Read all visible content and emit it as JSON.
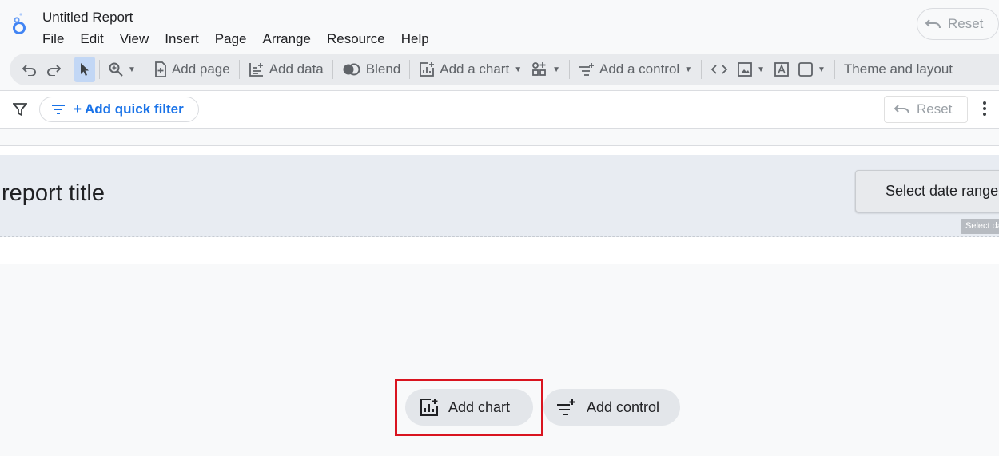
{
  "app": {
    "title": "Untitled Report",
    "reset_label": "Reset"
  },
  "menu": [
    "File",
    "Edit",
    "View",
    "Insert",
    "Page",
    "Arrange",
    "Resource",
    "Help"
  ],
  "toolbar": {
    "add_page": "Add page",
    "add_data": "Add data",
    "blend": "Blend",
    "add_chart": "Add a chart",
    "add_control": "Add a control",
    "theme": "Theme and layout"
  },
  "filterbar": {
    "quick_filter": "+ Add quick filter",
    "reset": "Reset"
  },
  "canvas": {
    "report_title": "report title",
    "date_range": "Select date range",
    "date_tooltip": "Select date range"
  },
  "actions": {
    "add_chart": "Add chart",
    "add_control": "Add control"
  },
  "colors": {
    "accent": "#1a73e8",
    "highlight": "#d9141f"
  }
}
